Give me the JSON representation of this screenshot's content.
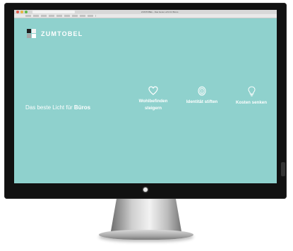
{
  "browser": {
    "window_title": "ZUMTOBEL - Das beste Licht für Büros",
    "traffic_lights": [
      "#e05b4b",
      "#e7b43b",
      "#5dbb4a"
    ]
  },
  "site": {
    "brand": "ZUMTOBEL",
    "logo_colors": [
      "#1e1e1e",
      "#f2f2f2",
      "#a8a8a8",
      "#ffffff"
    ],
    "headline_prefix": "Das beste Licht für ",
    "headline_bold": "Büros",
    "background_color": "#8fd1cd",
    "features": [
      {
        "icon": "heart-icon",
        "label_line1": "Wohlbefinden",
        "label_line2": "steigern"
      },
      {
        "icon": "fingerprint-icon",
        "label_line1": "Identität stiften",
        "label_line2": ""
      },
      {
        "icon": "lightbulb-icon",
        "label_line1": "Kosten senken",
        "label_line2": ""
      }
    ]
  }
}
